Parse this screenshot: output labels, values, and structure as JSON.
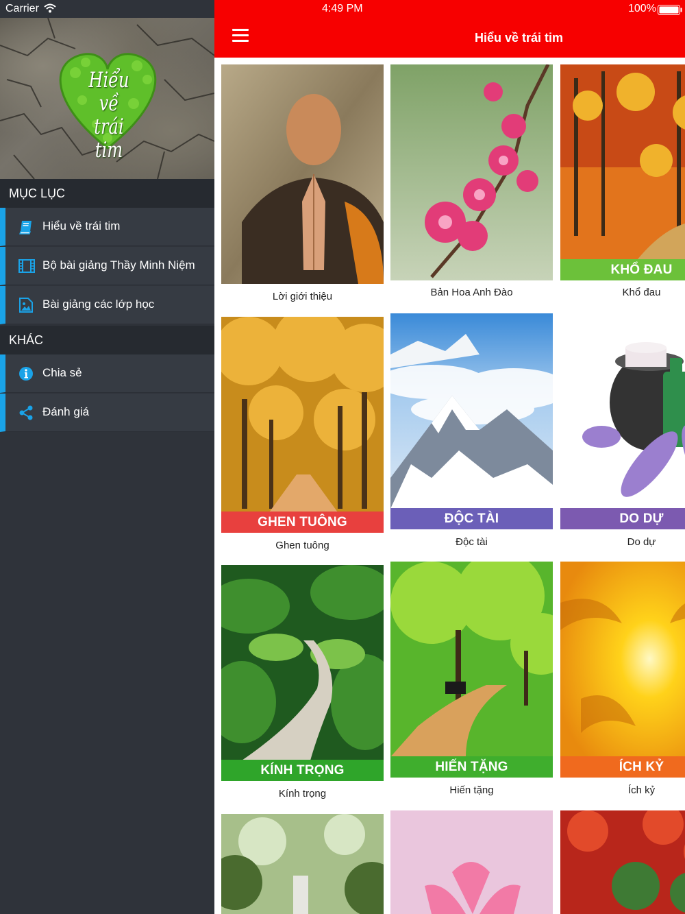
{
  "status": {
    "carrier": "Carrier",
    "time": "4:49 PM",
    "battery": "100%"
  },
  "sidebar": {
    "banner_text_line1": "Hiểu về",
    "banner_text_line2": "trái tim",
    "sections": [
      {
        "title": "MỤC LỤC",
        "items": [
          {
            "label": "Hiểu về trái tim",
            "icon": "book-icon"
          },
          {
            "label": "Bộ bài giảng Thầy Minh Niệm",
            "icon": "film-icon"
          },
          {
            "label": "Bài giảng các lớp học",
            "icon": "image-icon"
          }
        ]
      },
      {
        "title": "KHÁC",
        "items": [
          {
            "label": "Chia sẻ",
            "icon": "info-icon"
          },
          {
            "label": "Đánh giá",
            "icon": "share-icon"
          }
        ]
      }
    ],
    "accent_color": "#1aa3e8"
  },
  "header": {
    "title": "Hiểu về trái tim",
    "menu_icon": "hamburger-icon",
    "bar_color": "#f70000"
  },
  "grid": {
    "cards": [
      {
        "caption": "Lời giới thiệu",
        "banner": ""
      },
      {
        "caption": "Bản Hoa Anh Đào",
        "banner": ""
      },
      {
        "caption": "Khổ đau",
        "banner": "KHỔ ĐAU",
        "banner_color": "#6cc13a"
      },
      {
        "caption": "Ghen tuông",
        "banner": "GHEN TUÔNG",
        "banner_color": "#e8403e"
      },
      {
        "caption": "Độc tài",
        "banner": "ĐỘC TÀI",
        "banner_color": "#6b5fb8"
      },
      {
        "caption": "Do dự",
        "banner": "DO DỰ",
        "banner_color": "#7c5ab0"
      },
      {
        "caption": "Kính trọng",
        "banner": "KÍNH TRỌNG",
        "banner_color": "#2fa52a"
      },
      {
        "caption": "Hiến tặng",
        "banner": "HIẾN TẶNG",
        "banner_color": "#3fae2d"
      },
      {
        "caption": "Ích kỷ",
        "banner": "ÍCH KỶ",
        "banner_color": "#f06a1e"
      },
      {
        "caption": "",
        "banner": ""
      },
      {
        "caption": "",
        "banner": ""
      },
      {
        "caption": "",
        "banner": ""
      }
    ]
  }
}
